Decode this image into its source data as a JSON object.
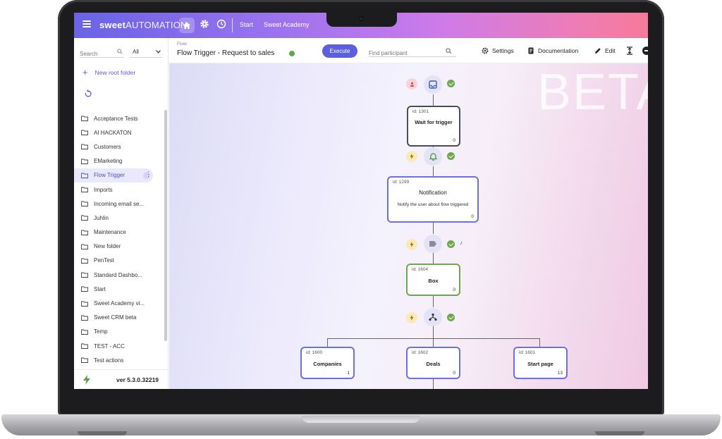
{
  "topbar": {
    "logo_bold": "sweet",
    "logo_light": "AUTOMATION",
    "links": [
      "Start",
      "Sweet Academy"
    ]
  },
  "sidebar": {
    "search_placeholder": "Search",
    "filter_value": "All",
    "new_root_label": "New root folder",
    "folders": [
      "Acceptance Tests",
      "AI HACKATON",
      "Customers",
      "EMarketing",
      "Flow Trigger",
      "Imports",
      "Incoming email se...",
      "Juhlin",
      "Maintenance",
      "New folder",
      "PenTest",
      "Standard Dashbo...",
      "Start",
      "Sweet Academy vi...",
      "Sweet CRM beta",
      "Temp",
      "TEST - ACC",
      "Test actions"
    ],
    "active_folder": "Flow Trigger",
    "version": "ver 5.3.0.32219"
  },
  "toolbar": {
    "crumb": "Flow",
    "title": "Flow Trigger - Request to sales",
    "execute_label": "Execute",
    "participant_placeholder": "Find participant",
    "settings_label": "Settings",
    "documentation_label": "Documentation",
    "edit_label": "Edit"
  },
  "canvas": {
    "watermark": "BETA",
    "nodes": [
      {
        "id": "id: 1301",
        "title": "Wait for trigger",
        "count": "0"
      },
      {
        "id": "id: 1299",
        "title": "Notification",
        "desc": "Notify the user about flow triggered",
        "count": "0"
      },
      {
        "id": "id: 1604",
        "title": "Box",
        "count": "0"
      },
      {
        "id": "id: 1600",
        "title": "Companies",
        "count": "1"
      },
      {
        "id": "id: 1602",
        "title": "Deals",
        "count": "0"
      },
      {
        "id": "id: 1601",
        "title": "Start page",
        "count": "13"
      }
    ],
    "side_mark": "♪"
  },
  "colors": {
    "accent": "#5b5fe0",
    "success": "#6fa84c",
    "node_border_dark": "#4d4d55",
    "node_border_blue": "#6a70e6",
    "node_border_green": "#6fa84c"
  }
}
